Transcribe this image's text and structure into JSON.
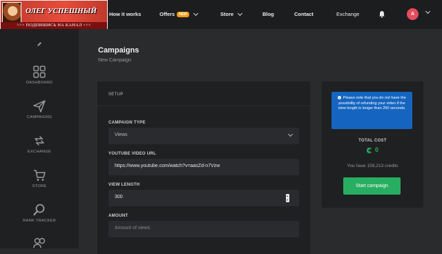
{
  "banner": {
    "name": "ОЛЕГ УСПЕШНЫЙ",
    "subscribe": ">>> ПОДПИШИСЬ НА КАНАЛ <<<"
  },
  "nav": {
    "items": [
      {
        "label": "How it works"
      },
      {
        "label": "Offers",
        "badge": "NEW"
      },
      {
        "label": "Store"
      },
      {
        "label": "Blog"
      },
      {
        "label": "Contact"
      },
      {
        "label": "Exchange"
      }
    ],
    "avatar_letter": "A"
  },
  "sidebar": {
    "items": [
      {
        "label": "DASHBOARD",
        "icon": "grid-icon"
      },
      {
        "label": "CAMPAIGNS",
        "icon": "send-icon"
      },
      {
        "label": "EXCHANGE",
        "icon": "exchange-icon"
      },
      {
        "label": "STORE",
        "icon": "cart-icon"
      },
      {
        "label": "RANK TRACKER",
        "icon": "search-icon"
      }
    ]
  },
  "page": {
    "title": "Campaigns",
    "subtitle": "New Campaign"
  },
  "setup": {
    "heading": "SETUP",
    "campaign_type_label": "CAMPAIGN TYPE",
    "campaign_type_value": "Views",
    "video_url_label": "YOUTUBE VIDEO URL",
    "video_url_value": "https://www.youtube.com/watch?v=aasZd-n7Vzw",
    "view_length_label": "VIEW LENGTH",
    "view_length_value": "300",
    "amount_label": "AMOUNT",
    "amount_placeholder": "Amount of views"
  },
  "cost": {
    "notice": "Please note that you do not have the possibility of refunding your video if the view length is longer than 250 seconds.",
    "total_label": "TOTAL COST",
    "total_value": "0",
    "credits_text": "You have 159,213 credits",
    "start_label": "Start campaign"
  },
  "colors": {
    "accent_green": "#27ae60",
    "notice_blue": "#1565c0",
    "badge_orange": "#f39c12",
    "avatar_red": "#e74c5c"
  }
}
